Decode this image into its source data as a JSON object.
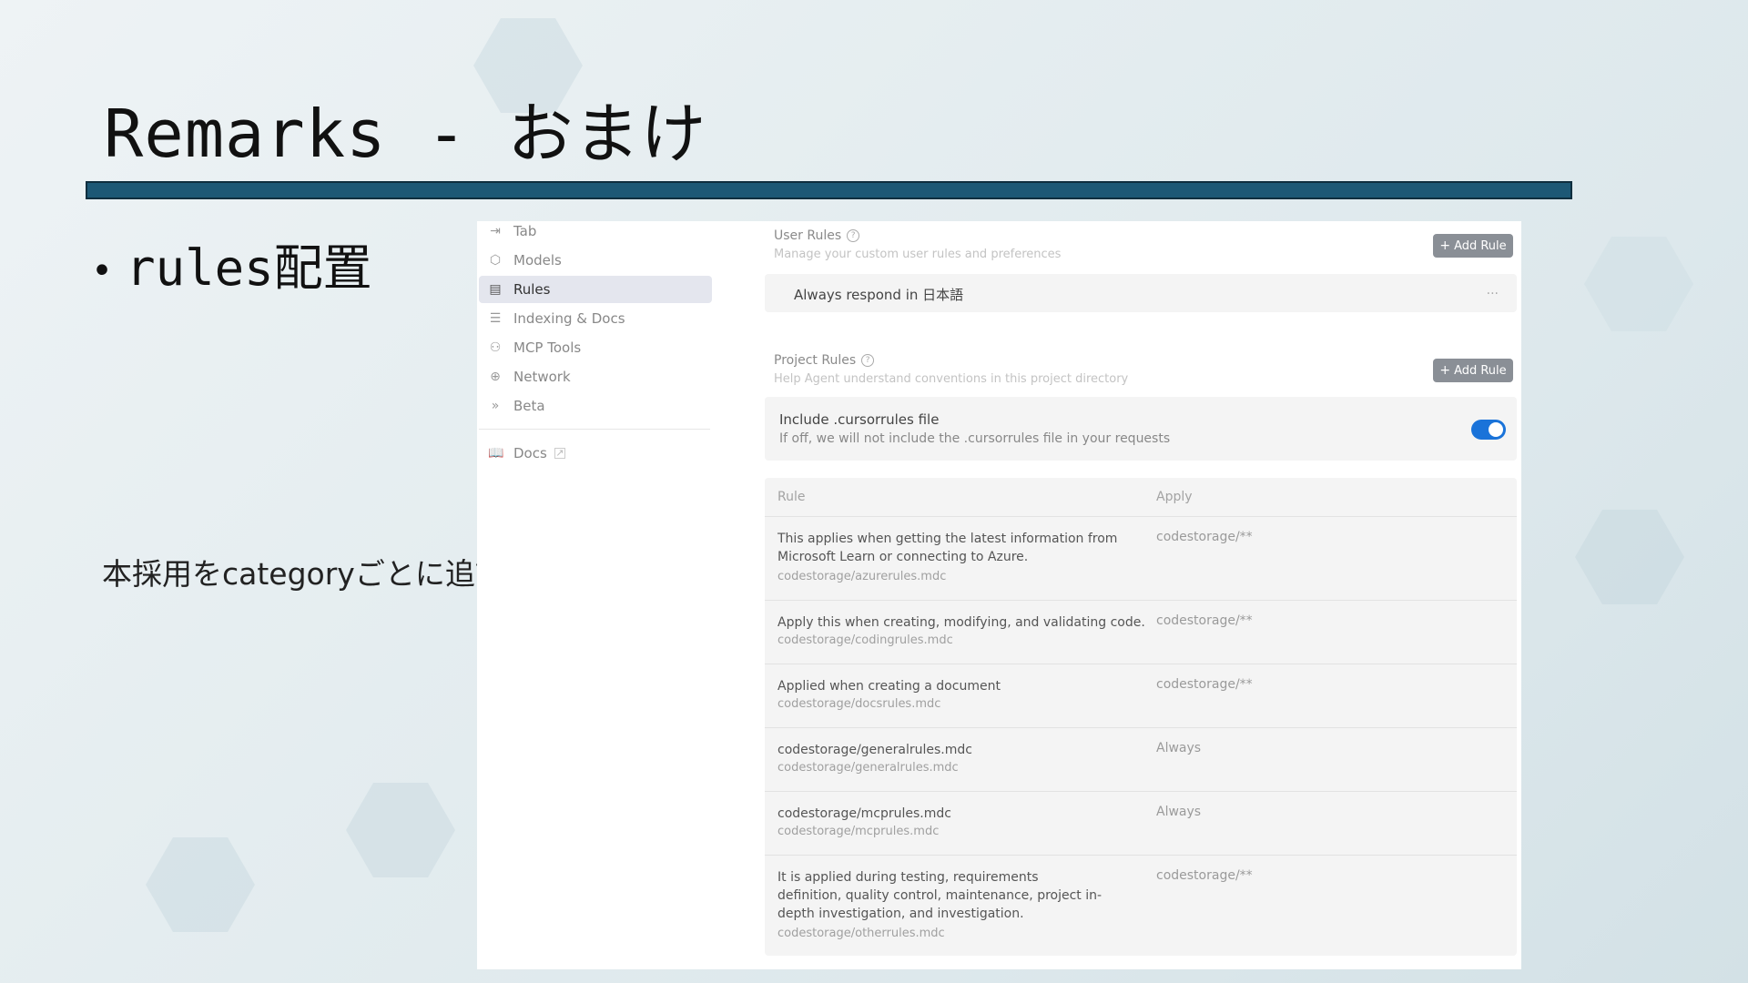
{
  "slide": {
    "title": "Remarks - おまけ",
    "bullet": "rules配置",
    "note": "本採用をcategoryごとに追記する",
    "accent_bar_color": "#1d5875",
    "arrow_color": "#00a8e8"
  },
  "sidebar": {
    "items": [
      {
        "label": "Tab",
        "icon": "arrow-right-bar-icon"
      },
      {
        "label": "Models",
        "icon": "cube-icon"
      },
      {
        "label": "Rules",
        "icon": "clipboard-icon",
        "active": true
      },
      {
        "label": "Indexing & Docs",
        "icon": "database-icon"
      },
      {
        "label": "MCP Tools",
        "icon": "tools-network-icon"
      },
      {
        "label": "Network",
        "icon": "globe-icon"
      },
      {
        "label": "Beta",
        "icon": "double-chevron-icon"
      }
    ],
    "docs_label": "Docs"
  },
  "user_rules": {
    "title": "User Rules",
    "subtitle": "Manage your custom user rules and preferences",
    "add_label": "Add Rule",
    "rule_text": "Always respond in 日本語",
    "more": "···"
  },
  "project_rules": {
    "title": "Project Rules",
    "subtitle": "Help Agent understand conventions in this project directory",
    "add_label": "Add Rule",
    "include_title": "Include .cursorrules file",
    "include_sub": "If off, we will not include the .cursorrules file in your requests",
    "include_enabled": true
  },
  "rules_table": {
    "headers": {
      "rule": "Rule",
      "apply": "Apply"
    },
    "rows": [
      {
        "desc": "This applies when getting the latest information from Microsoft Learn or connecting to Azure.",
        "path": "codestorage/azurerules.mdc",
        "apply": "codestorage/**"
      },
      {
        "desc": "Apply this when creating, modifying, and validating code.",
        "path": "codestorage/codingrules.mdc",
        "apply": "codestorage/**"
      },
      {
        "desc": "Applied when creating a document",
        "path": "codestorage/docsrules.mdc",
        "apply": "codestorage/**"
      },
      {
        "desc": "codestorage/generalrules.mdc",
        "path": "codestorage/generalrules.mdc",
        "apply": "Always"
      },
      {
        "desc": "codestorage/mcprules.mdc",
        "path": "codestorage/mcprules.mdc",
        "apply": "Always"
      },
      {
        "desc": "It is applied during testing, requirements definition, quality control, maintenance, project in-depth investigation, and investigation.",
        "path": "codestorage/otherrules.mdc",
        "apply": "codestorage/**"
      }
    ]
  }
}
